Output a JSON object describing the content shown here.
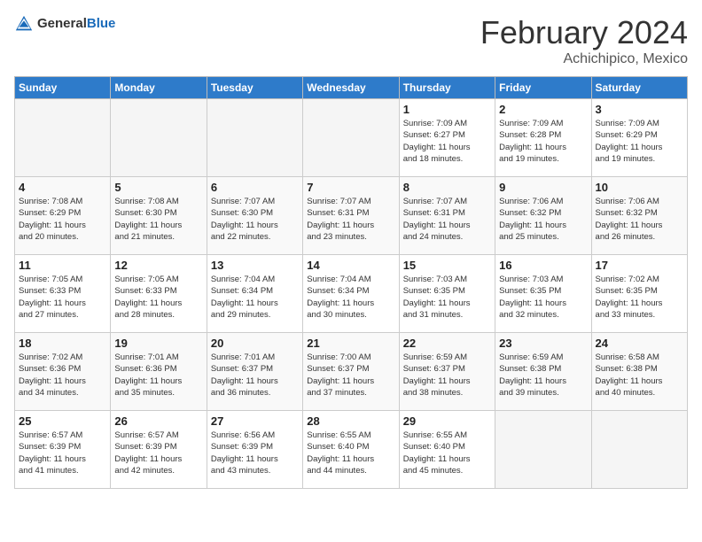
{
  "header": {
    "logo_general": "General",
    "logo_blue": "Blue",
    "month_year": "February 2024",
    "location": "Achichipico, Mexico"
  },
  "days_of_week": [
    "Sunday",
    "Monday",
    "Tuesday",
    "Wednesday",
    "Thursday",
    "Friday",
    "Saturday"
  ],
  "weeks": [
    [
      {
        "day": "",
        "info": ""
      },
      {
        "day": "",
        "info": ""
      },
      {
        "day": "",
        "info": ""
      },
      {
        "day": "",
        "info": ""
      },
      {
        "day": "1",
        "info": "Sunrise: 7:09 AM\nSunset: 6:27 PM\nDaylight: 11 hours\nand 18 minutes."
      },
      {
        "day": "2",
        "info": "Sunrise: 7:09 AM\nSunset: 6:28 PM\nDaylight: 11 hours\nand 19 minutes."
      },
      {
        "day": "3",
        "info": "Sunrise: 7:09 AM\nSunset: 6:29 PM\nDaylight: 11 hours\nand 19 minutes."
      }
    ],
    [
      {
        "day": "4",
        "info": "Sunrise: 7:08 AM\nSunset: 6:29 PM\nDaylight: 11 hours\nand 20 minutes."
      },
      {
        "day": "5",
        "info": "Sunrise: 7:08 AM\nSunset: 6:30 PM\nDaylight: 11 hours\nand 21 minutes."
      },
      {
        "day": "6",
        "info": "Sunrise: 7:07 AM\nSunset: 6:30 PM\nDaylight: 11 hours\nand 22 minutes."
      },
      {
        "day": "7",
        "info": "Sunrise: 7:07 AM\nSunset: 6:31 PM\nDaylight: 11 hours\nand 23 minutes."
      },
      {
        "day": "8",
        "info": "Sunrise: 7:07 AM\nSunset: 6:31 PM\nDaylight: 11 hours\nand 24 minutes."
      },
      {
        "day": "9",
        "info": "Sunrise: 7:06 AM\nSunset: 6:32 PM\nDaylight: 11 hours\nand 25 minutes."
      },
      {
        "day": "10",
        "info": "Sunrise: 7:06 AM\nSunset: 6:32 PM\nDaylight: 11 hours\nand 26 minutes."
      }
    ],
    [
      {
        "day": "11",
        "info": "Sunrise: 7:05 AM\nSunset: 6:33 PM\nDaylight: 11 hours\nand 27 minutes."
      },
      {
        "day": "12",
        "info": "Sunrise: 7:05 AM\nSunset: 6:33 PM\nDaylight: 11 hours\nand 28 minutes."
      },
      {
        "day": "13",
        "info": "Sunrise: 7:04 AM\nSunset: 6:34 PM\nDaylight: 11 hours\nand 29 minutes."
      },
      {
        "day": "14",
        "info": "Sunrise: 7:04 AM\nSunset: 6:34 PM\nDaylight: 11 hours\nand 30 minutes."
      },
      {
        "day": "15",
        "info": "Sunrise: 7:03 AM\nSunset: 6:35 PM\nDaylight: 11 hours\nand 31 minutes."
      },
      {
        "day": "16",
        "info": "Sunrise: 7:03 AM\nSunset: 6:35 PM\nDaylight: 11 hours\nand 32 minutes."
      },
      {
        "day": "17",
        "info": "Sunrise: 7:02 AM\nSunset: 6:35 PM\nDaylight: 11 hours\nand 33 minutes."
      }
    ],
    [
      {
        "day": "18",
        "info": "Sunrise: 7:02 AM\nSunset: 6:36 PM\nDaylight: 11 hours\nand 34 minutes."
      },
      {
        "day": "19",
        "info": "Sunrise: 7:01 AM\nSunset: 6:36 PM\nDaylight: 11 hours\nand 35 minutes."
      },
      {
        "day": "20",
        "info": "Sunrise: 7:01 AM\nSunset: 6:37 PM\nDaylight: 11 hours\nand 36 minutes."
      },
      {
        "day": "21",
        "info": "Sunrise: 7:00 AM\nSunset: 6:37 PM\nDaylight: 11 hours\nand 37 minutes."
      },
      {
        "day": "22",
        "info": "Sunrise: 6:59 AM\nSunset: 6:37 PM\nDaylight: 11 hours\nand 38 minutes."
      },
      {
        "day": "23",
        "info": "Sunrise: 6:59 AM\nSunset: 6:38 PM\nDaylight: 11 hours\nand 39 minutes."
      },
      {
        "day": "24",
        "info": "Sunrise: 6:58 AM\nSunset: 6:38 PM\nDaylight: 11 hours\nand 40 minutes."
      }
    ],
    [
      {
        "day": "25",
        "info": "Sunrise: 6:57 AM\nSunset: 6:39 PM\nDaylight: 11 hours\nand 41 minutes."
      },
      {
        "day": "26",
        "info": "Sunrise: 6:57 AM\nSunset: 6:39 PM\nDaylight: 11 hours\nand 42 minutes."
      },
      {
        "day": "27",
        "info": "Sunrise: 6:56 AM\nSunset: 6:39 PM\nDaylight: 11 hours\nand 43 minutes."
      },
      {
        "day": "28",
        "info": "Sunrise: 6:55 AM\nSunset: 6:40 PM\nDaylight: 11 hours\nand 44 minutes."
      },
      {
        "day": "29",
        "info": "Sunrise: 6:55 AM\nSunset: 6:40 PM\nDaylight: 11 hours\nand 45 minutes."
      },
      {
        "day": "",
        "info": ""
      },
      {
        "day": "",
        "info": ""
      }
    ]
  ]
}
